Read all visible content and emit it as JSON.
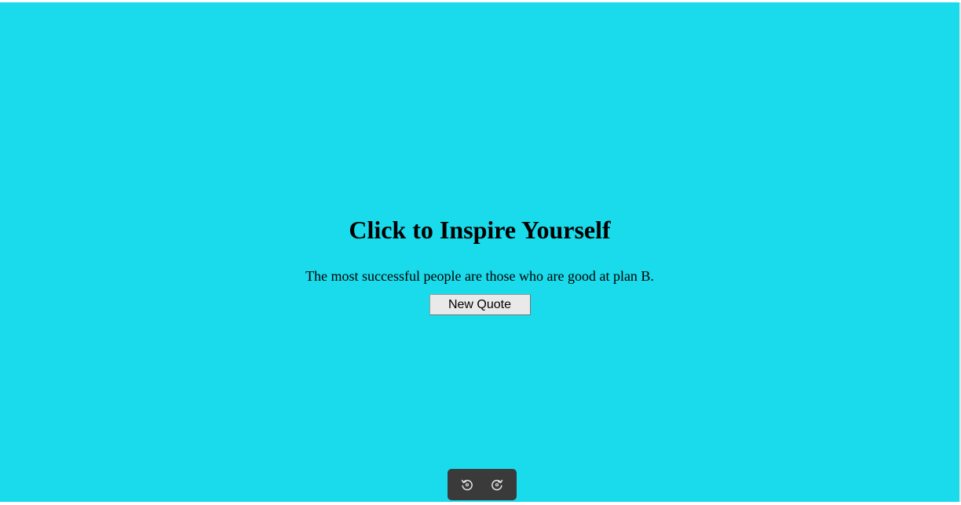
{
  "page": {
    "title": "Click to Inspire Yourself",
    "quote": "The most successful people are those who are good at plan B.",
    "button_label": "New Quote",
    "background_color": "#19dbeb"
  },
  "toolbar": {
    "items": [
      {
        "icon": "rotate-left-icon"
      },
      {
        "icon": "rotate-right-icon"
      }
    ]
  }
}
